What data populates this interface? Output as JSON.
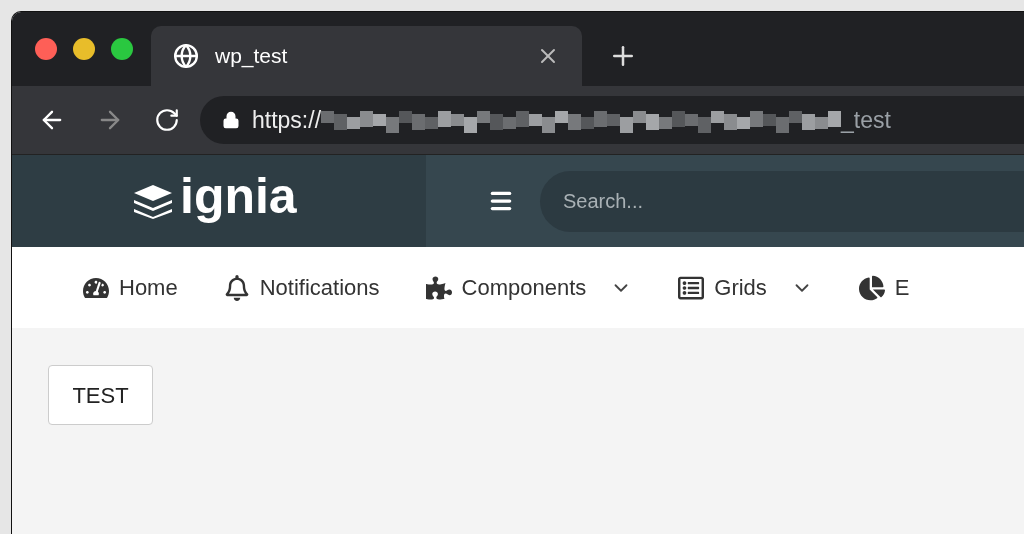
{
  "browser": {
    "tab": {
      "title": "wp_test",
      "selected": true
    },
    "address": {
      "prefix": "https://",
      "suffix": "_test"
    }
  },
  "header": {
    "logo": "ignia",
    "search": {
      "placeholder": "Search..."
    }
  },
  "nav": [
    {
      "label": "Home",
      "dropdown": false
    },
    {
      "label": "Notifications",
      "dropdown": false
    },
    {
      "label": "Components",
      "dropdown": true
    },
    {
      "label": "Grids",
      "dropdown": true
    },
    {
      "label": "E",
      "dropdown": false
    }
  ],
  "content": {
    "button": "TEST"
  }
}
